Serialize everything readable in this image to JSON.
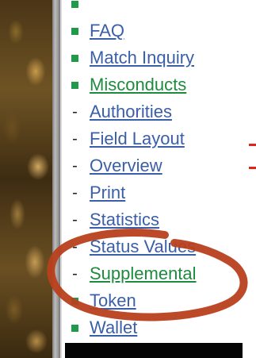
{
  "nav": {
    "items": [
      {
        "label": "",
        "bullet": "square",
        "state": "cut"
      },
      {
        "label": "FAQ",
        "bullet": "square"
      },
      {
        "label": "Match Inquiry",
        "bullet": "square"
      },
      {
        "label": "Misconducts",
        "bullet": "square",
        "state": "active"
      },
      {
        "label": "Authorities",
        "bullet": "dash"
      },
      {
        "label": "Field Layout",
        "bullet": "dash"
      },
      {
        "label": "Overview",
        "bullet": "dash"
      },
      {
        "label": "Print",
        "bullet": "dash"
      },
      {
        "label": "Statistics",
        "bullet": "dash"
      },
      {
        "label": "Status Values",
        "bullet": "dash"
      },
      {
        "label": "Supplemental",
        "bullet": "dash",
        "state": "active"
      },
      {
        "label": "Token",
        "bullet": "square"
      },
      {
        "label": "Wallet",
        "bullet": "square"
      }
    ]
  },
  "colors": {
    "link": "#3a5fa8",
    "visited_link": "#1e8a3e",
    "bullet": "#1e9a4a",
    "annotation": "#b8401c",
    "edge_marks": "#e0231b"
  }
}
